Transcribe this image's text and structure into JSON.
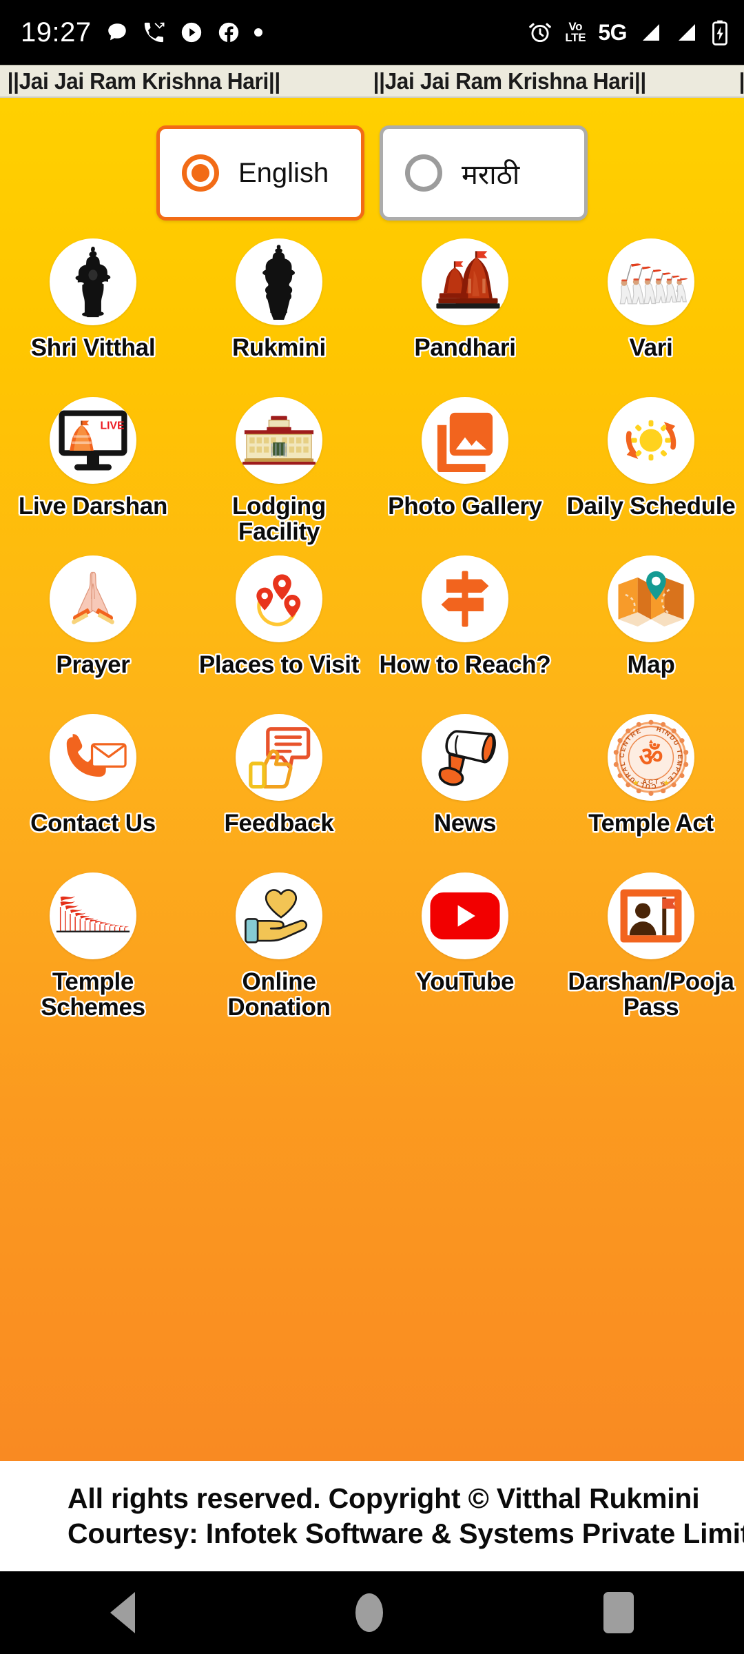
{
  "status_bar": {
    "time": "19:27",
    "left_icons": [
      "chat-bubble-icon",
      "missed-call-icon",
      "play-circle-icon",
      "facebook-icon",
      "dot-icon"
    ],
    "alarm_icon": "alarm-clock-icon",
    "volte_top": "Vo",
    "volte_bottom": "LTE",
    "network": "5G",
    "signal_icons": [
      "signal-bars-icon",
      "signal-bars-icon"
    ],
    "battery_icon": "battery-charging-icon"
  },
  "marquee": {
    "text": "||Jai Jai Ram Krishna Hari||"
  },
  "language": {
    "options": [
      {
        "label": "English",
        "selected": true,
        "radio_icon": "radio-selected-icon"
      },
      {
        "label": "मराठी",
        "selected": false,
        "radio_icon": "radio-unselected-icon"
      }
    ]
  },
  "grid": {
    "items": [
      {
        "label": "Shri Vitthal",
        "icon": "vitthal-deity-icon"
      },
      {
        "label": "Rukmini",
        "icon": "rukmini-deity-icon"
      },
      {
        "label": "Pandhari",
        "icon": "temple-domes-icon"
      },
      {
        "label": "Vari",
        "icon": "pilgrim-procession-icon"
      },
      {
        "label": "Live Darshan",
        "icon": "live-monitor-icon"
      },
      {
        "label": "Lodging Facility",
        "icon": "lodging-building-icon"
      },
      {
        "label": "Photo Gallery",
        "icon": "photo-gallery-icon"
      },
      {
        "label": "Daily Schedule",
        "icon": "sun-refresh-icon"
      },
      {
        "label": "Prayer",
        "icon": "praying-hands-icon"
      },
      {
        "label": "Places to Visit",
        "icon": "map-pins-icon"
      },
      {
        "label": "How to Reach?",
        "icon": "signpost-icon"
      },
      {
        "label": "Map",
        "icon": "folded-map-pin-icon"
      },
      {
        "label": "Contact Us",
        "icon": "phone-envelope-icon"
      },
      {
        "label": "Feedback",
        "icon": "thumbs-up-chat-icon"
      },
      {
        "label": "News",
        "icon": "megaphone-icon"
      },
      {
        "label": "Temple Act",
        "icon": "om-seal-icon"
      },
      {
        "label": "Temple Schemes",
        "icon": "red-flags-icon"
      },
      {
        "label": "Online Donation",
        "icon": "hand-heart-icon"
      },
      {
        "label": "YouTube",
        "icon": "youtube-icon"
      },
      {
        "label": "Darshan/Pooja Pass",
        "icon": "darshan-pass-icon"
      }
    ]
  },
  "footer": {
    "line1": "All rights reserved. Copyright © Vitthal Rukmini",
    "line2": "Courtesy: Infotek Software & Systems Private Limit"
  },
  "nav_bar": {
    "back": "back-icon",
    "home": "home-icon",
    "recents": "recents-icon"
  },
  "colors": {
    "accent_orange": "#F26B16",
    "bg_top": "#FFD000",
    "bg_bottom": "#F98A22",
    "marquee_bg": "#ECEADD"
  }
}
